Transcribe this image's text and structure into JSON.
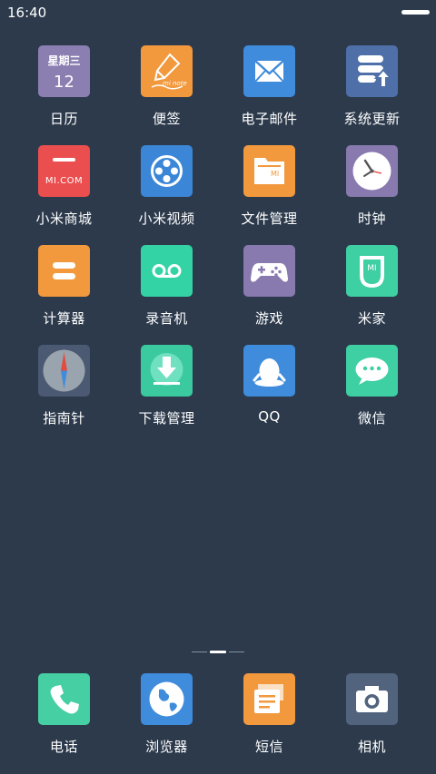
{
  "status": {
    "time": "16:40"
  },
  "apps": [
    [
      {
        "name": "calendar",
        "label": "日历",
        "color": "#8b7fb2",
        "icon": "calendar-icon",
        "weekday": "星期三",
        "day": "12"
      },
      {
        "name": "notes",
        "label": "便签",
        "color": "#f2983d",
        "icon": "pen-note-icon",
        "caption": "mi note"
      },
      {
        "name": "email",
        "label": "电子邮件",
        "color": "#3f8bdc",
        "icon": "envelope-icon"
      },
      {
        "name": "system-update",
        "label": "系统更新",
        "color": "#4e6fa8",
        "icon": "update-stack-icon"
      }
    ],
    [
      {
        "name": "mi-mall",
        "label": "小米商城",
        "color": "#ea4e4e",
        "icon": "shop-bag-icon",
        "caption": "MI.COM"
      },
      {
        "name": "mi-video",
        "label": "小米视频",
        "color": "#3b86d6",
        "icon": "film-reel-icon"
      },
      {
        "name": "file-manager",
        "label": "文件管理",
        "color": "#f2983d",
        "icon": "folder-icon",
        "caption": "MI"
      },
      {
        "name": "clock",
        "label": "时钟",
        "color": "#8879ae",
        "icon": "clock-icon"
      }
    ],
    [
      {
        "name": "calculator",
        "label": "计算器",
        "color": "#f2983d",
        "icon": "equals-icon"
      },
      {
        "name": "recorder",
        "label": "录音机",
        "color": "#33d3a5",
        "icon": "voicemail-icon"
      },
      {
        "name": "games",
        "label": "游戏",
        "color": "#8879ae",
        "icon": "gamepad-icon"
      },
      {
        "name": "mi-home",
        "label": "米家",
        "color": "#3ecfa3",
        "icon": "mijia-icon"
      }
    ],
    [
      {
        "name": "compass",
        "label": "指南针",
        "color": "#4b5a72",
        "icon": "compass-icon"
      },
      {
        "name": "download-manager",
        "label": "下载管理",
        "color": "#3bc9a0",
        "icon": "download-icon"
      },
      {
        "name": "qq",
        "label": "QQ",
        "color": "#3f8bdc",
        "icon": "penguin-icon"
      },
      {
        "name": "wechat",
        "label": "微信",
        "color": "#3ecfa3",
        "icon": "chat-bubbles-icon"
      }
    ]
  ],
  "dock": [
    {
      "name": "phone",
      "label": "电话",
      "color": "#46cfa3",
      "icon": "phone-icon"
    },
    {
      "name": "browser",
      "label": "浏览器",
      "color": "#3f8bdc",
      "icon": "globe-icon"
    },
    {
      "name": "sms",
      "label": "短信",
      "color": "#f2983d",
      "icon": "message-icon"
    },
    {
      "name": "camera",
      "label": "相机",
      "color": "#52637e",
      "icon": "camera-icon"
    }
  ],
  "pages": {
    "count": 3,
    "active": 2
  }
}
